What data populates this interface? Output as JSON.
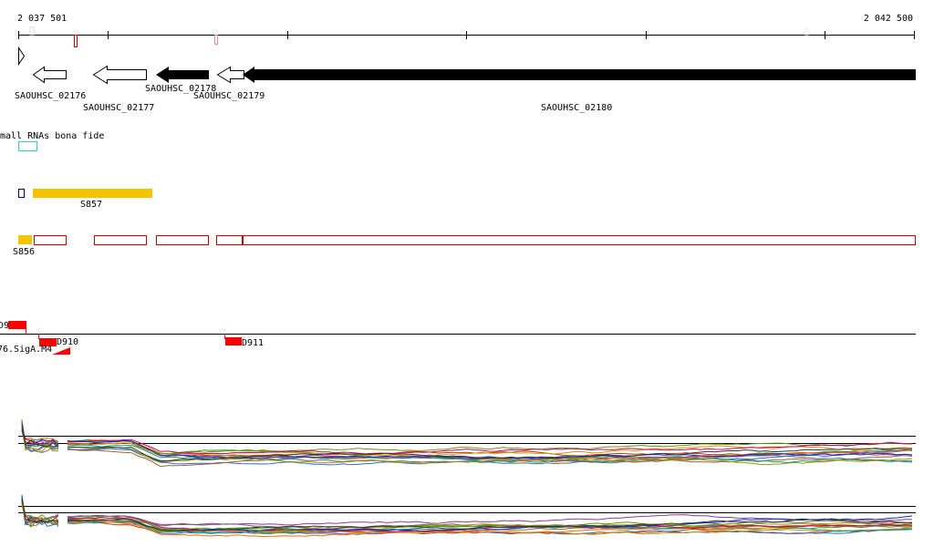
{
  "ruler": {
    "start_label": "2 037 501",
    "end_label": "2 042 500"
  },
  "genes": [
    {
      "id": "SAOUHSC_02176",
      "strand": "-",
      "fill": "#ffffff"
    },
    {
      "id": "SAOUHSC_02177",
      "strand": "-",
      "fill": "#ffffff"
    },
    {
      "id": "SAOUHSC_02178",
      "strand": "-",
      "fill": "#000000"
    },
    {
      "id": "SAOUHSC_02179",
      "strand": "-",
      "fill": "#ffffff"
    },
    {
      "id": "SAOUHSC_02180",
      "strand": "-",
      "fill": "#000000"
    }
  ],
  "tracks": {
    "small_rna_title": "mall RNAs bona fide",
    "features": [
      {
        "label": "S857",
        "color": "#f5c400"
      },
      {
        "label": "S856",
        "color": "#f5c400"
      }
    ],
    "promoters": [
      {
        "label": "D9"
      },
      {
        "label": "D910"
      },
      {
        "label": "D911"
      },
      {
        "label": "76.SigA.M4"
      }
    ]
  },
  "colors": {
    "outline_red": "#cc0000",
    "cyan": "#33cccc",
    "navy": "#000080",
    "feature_gold": "#f5c400",
    "promoter_red": "#ff0000"
  }
}
